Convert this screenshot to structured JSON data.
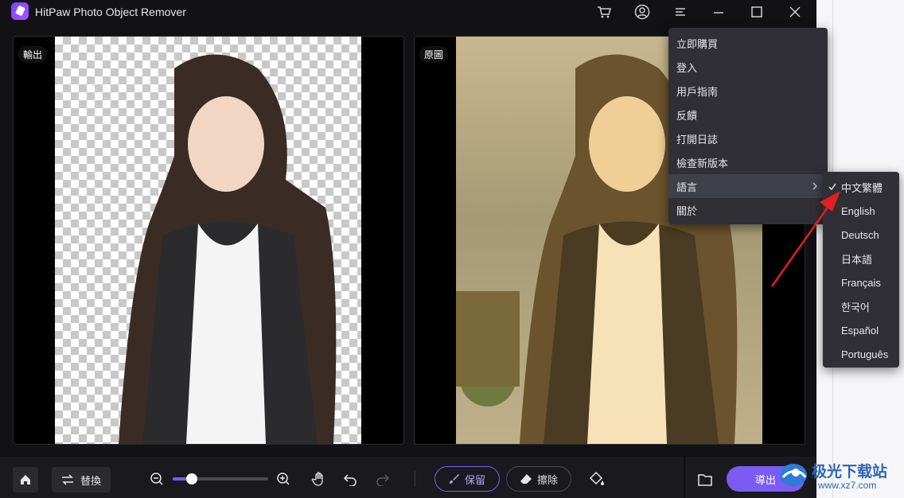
{
  "app": {
    "title": "HitPaw Photo Object Remover"
  },
  "panels": {
    "output_label": "輸出",
    "original_label": "原圖"
  },
  "toolbar": {
    "replace_label": "替換",
    "keep_label": "保留",
    "erase_label": "擦除",
    "export_label": "導出",
    "zoom_level": 0.2
  },
  "menu": {
    "items": [
      "立即購買",
      "登入",
      "用戶指南",
      "反饋",
      "打開日誌",
      "檢查新版本",
      "語言",
      "關於"
    ],
    "language_submenu": {
      "options": [
        "中文繁體",
        "English",
        "Deutsch",
        "日本語",
        "Français",
        "한국어",
        "Español",
        "Português"
      ],
      "selected": "中文繁體"
    }
  },
  "watermark": {
    "name": "极光下载站",
    "url": "www.xz7.com"
  },
  "colors": {
    "accent": "#7a5cf5",
    "menu_bg": "#2f2f35",
    "annotation_arrow": "#e02020"
  }
}
